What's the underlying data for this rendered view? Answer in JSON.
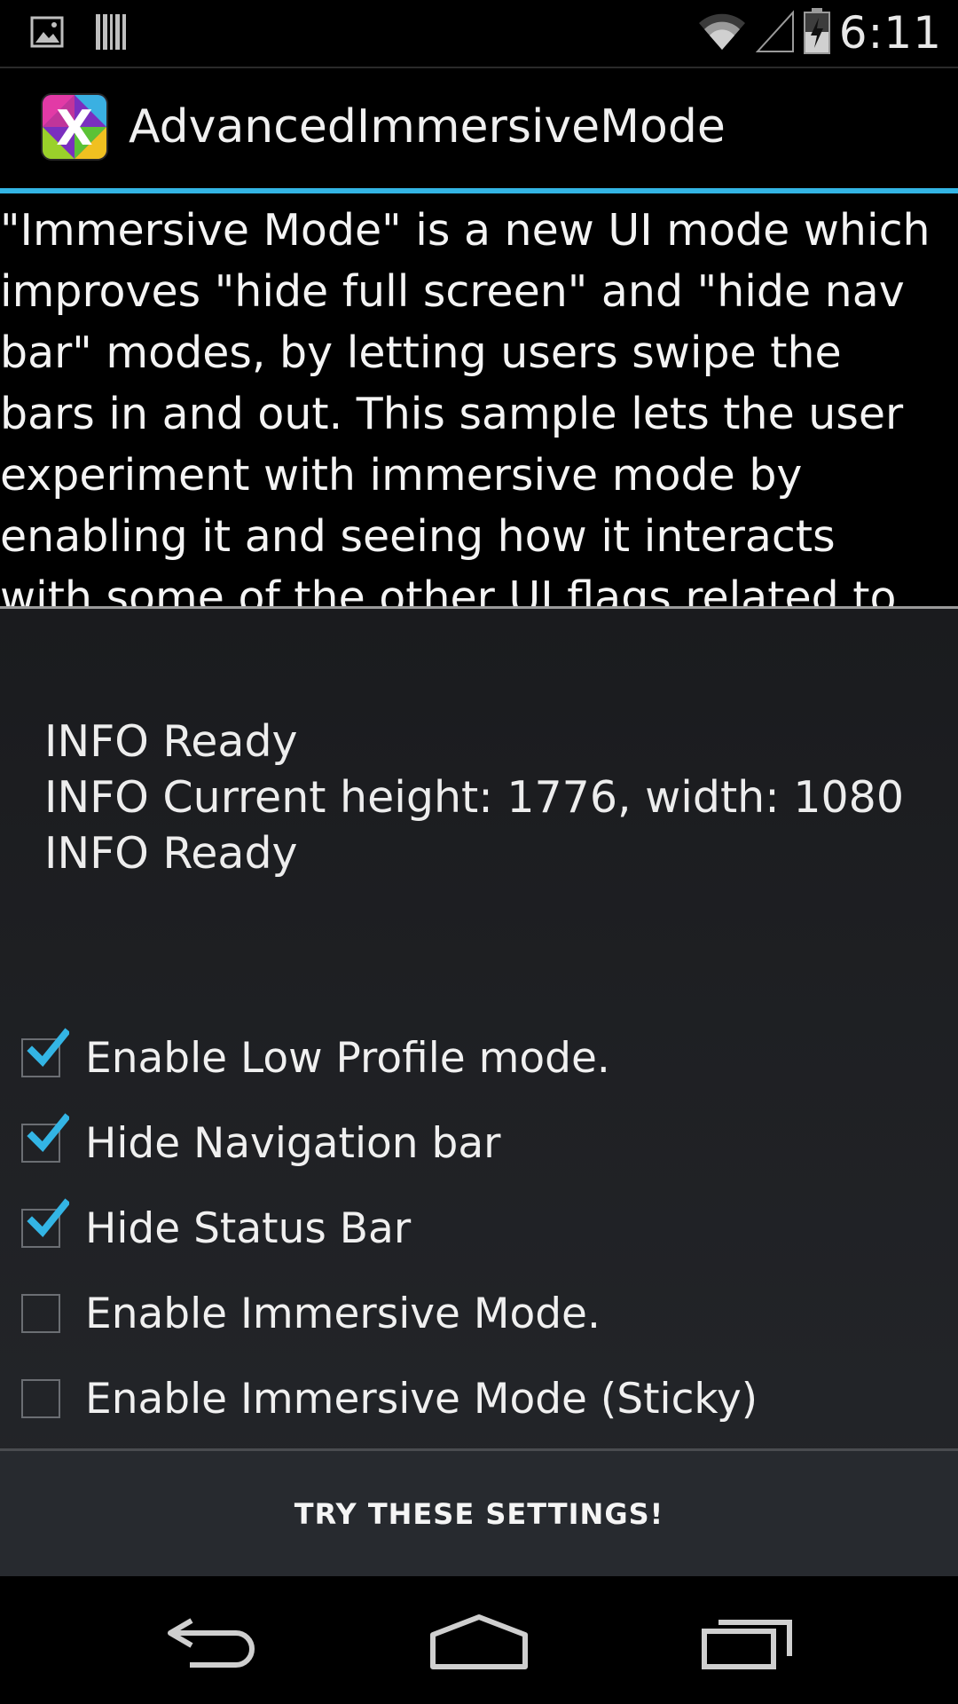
{
  "status_bar": {
    "time": "6:11",
    "icons": [
      "image-icon",
      "barcode-icon",
      "wifi-icon",
      "signal-icon",
      "battery-icon"
    ]
  },
  "action_bar": {
    "title": "AdvancedImmersiveMode",
    "icon": "app-x-icon"
  },
  "description": "\"Immersive Mode\" is a new UI mode which improves \"hide full screen\" and \"hide nav bar\" modes, by letting users swipe the bars in and out.  This sample lets the user experiment with immersive mode by enabling it and seeing how it interacts with some of the other UI flags related to full-",
  "log": [
    "INFO Ready",
    "INFO Current height: 1776, width: 1080",
    "INFO Ready"
  ],
  "options": [
    {
      "label": "Enable Low Profile mode.",
      "checked": true
    },
    {
      "label": "Hide Navigation bar",
      "checked": true
    },
    {
      "label": "Hide Status Bar",
      "checked": true
    },
    {
      "label": "Enable Immersive Mode.",
      "checked": false
    },
    {
      "label": "Enable Immersive Mode (Sticky)",
      "checked": false
    }
  ],
  "button": {
    "label": "TRY THESE SETTINGS!"
  },
  "nav_bar": {
    "buttons": [
      "back-icon",
      "home-icon",
      "recents-icon"
    ]
  },
  "colors": {
    "accent": "#33b5e5",
    "background": "#000000",
    "panel": "#1e2024"
  }
}
